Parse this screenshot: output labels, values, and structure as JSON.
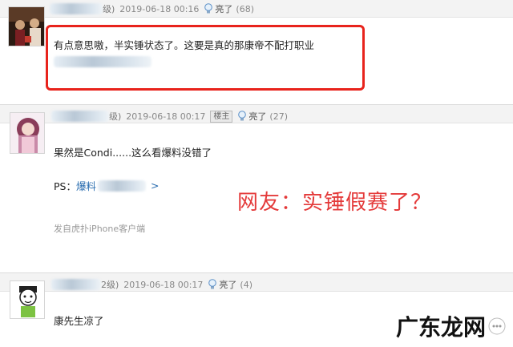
{
  "posts": [
    {
      "level": "级)",
      "time": "2019-06-18 00:16",
      "light_label": "亮了",
      "light_count": "(68)",
      "lines": [
        "有点意思嗷，半实锤状态了。这要是真的那康帝不配打职业"
      ]
    },
    {
      "level": "级)",
      "time": "2019-06-18 00:17",
      "badge": "楼主",
      "light_label": "亮了",
      "light_count": "(27)",
      "lines": [
        "果然是Condi......这么看爆料没错了"
      ],
      "ps_prefix": "PS：",
      "ps_link": "爆料",
      "ps_arrow": ">",
      "source": "发自虎扑iPhone客户端"
    },
    {
      "level": "2级)",
      "time": "2019-06-18 00:17",
      "light_label": "亮了",
      "light_count": "(4)",
      "lines": [
        "康先生凉了"
      ]
    }
  ],
  "annotation": "网友：实锤假赛了？",
  "watermark": "广东龙网",
  "colors": {
    "highlight": "#e8231c",
    "annotation": "#e43a3a",
    "link": "#2a6db0",
    "header_bg": "#f3f3f3"
  }
}
